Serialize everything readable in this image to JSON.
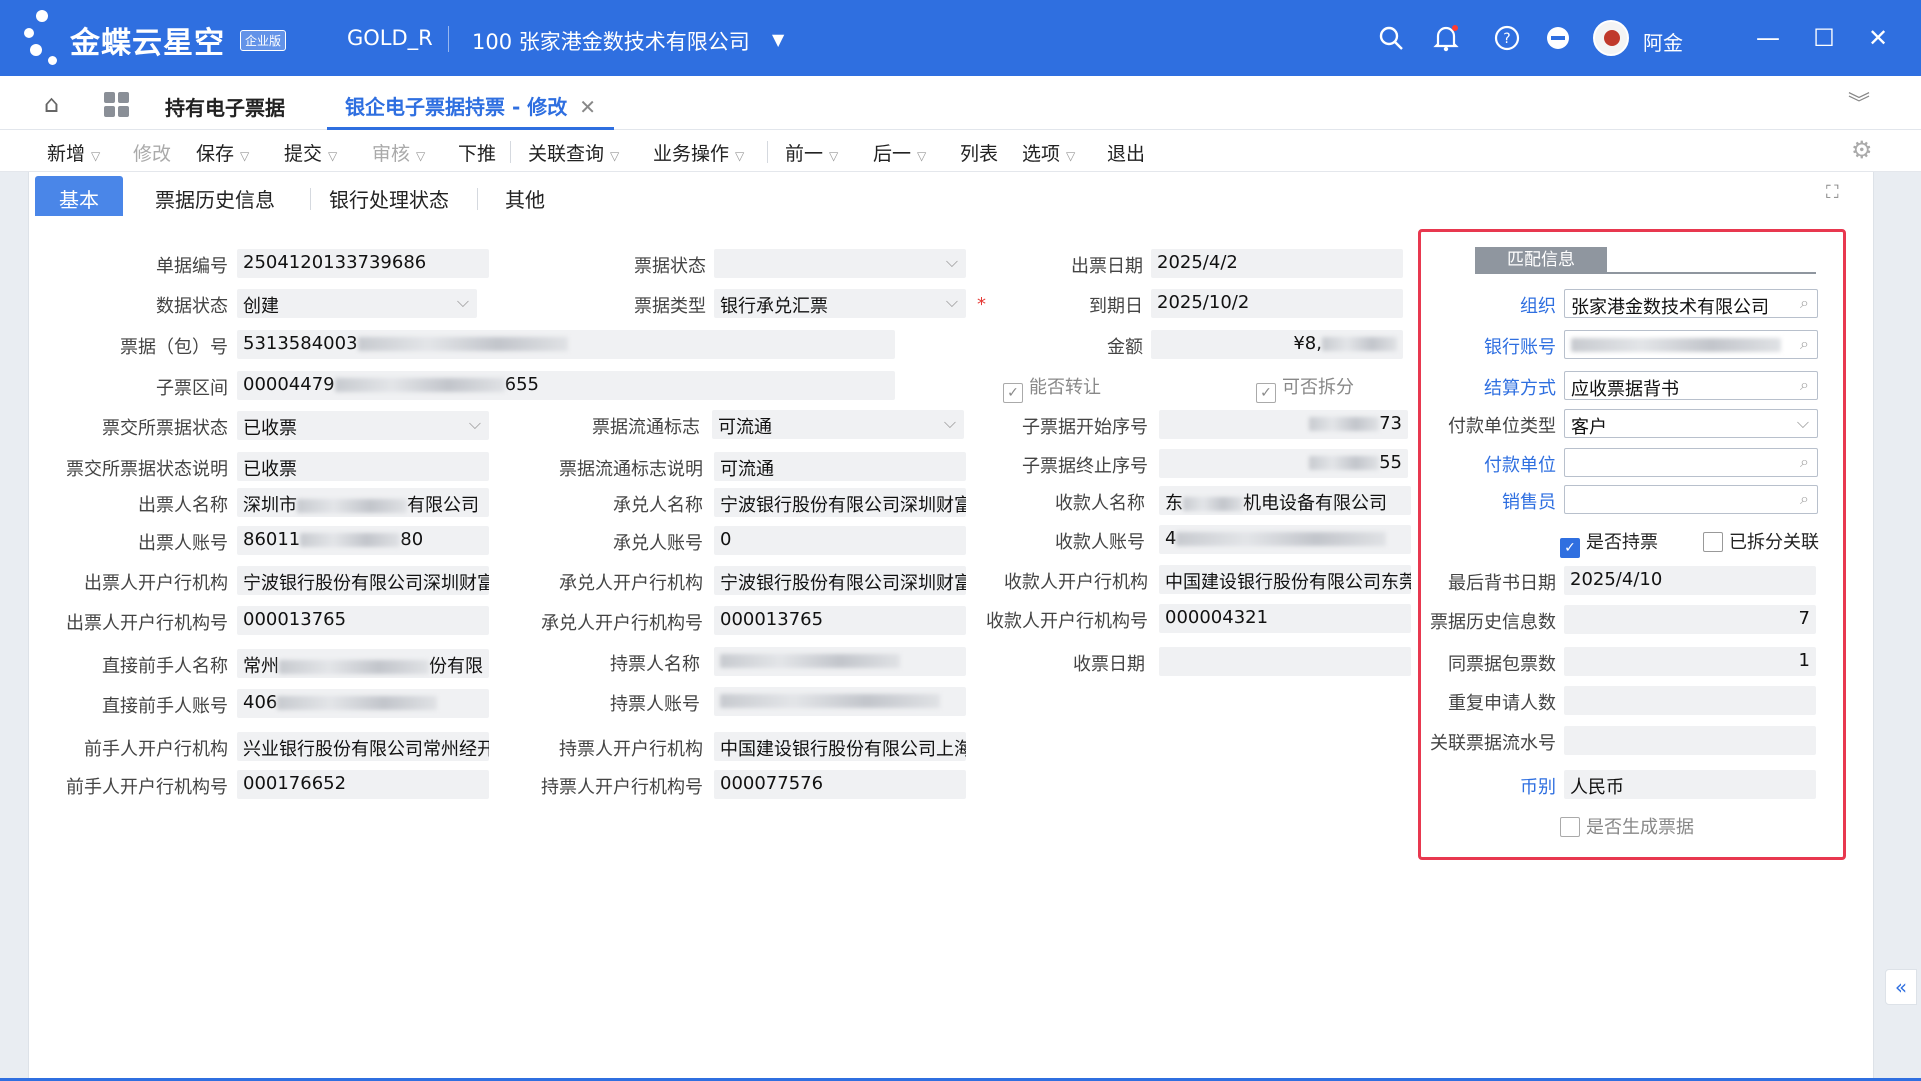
{
  "header": {
    "brand": "金蝶云星空",
    "edition": "企业版",
    "account": "GOLD_R",
    "company": "100 张家港金数技术有限公司",
    "user": "阿金",
    "icons": [
      "search-icon",
      "bell-icon",
      "help-icon",
      "minus-circle-icon"
    ]
  },
  "tabs": {
    "list_tab": "持有电子票据",
    "active_tab": "银企电子票据持票 - 修改"
  },
  "toolbar": {
    "items": [
      "新增",
      "修改",
      "保存",
      "提交",
      "审核",
      "下推",
      "关联查询",
      "业务操作",
      "前一",
      "后一",
      "列表",
      "选项",
      "退出"
    ]
  },
  "subtabs": [
    "基本",
    "票据历史信息",
    "银行处理状态",
    "其他"
  ],
  "form": {
    "col1": {
      "labels": [
        "单据编号",
        "数据状态",
        "票据（包）号",
        "子票区间",
        "票交所票据状态",
        "票交所票据状态说明",
        "出票人名称",
        "出票人账号",
        "出票人开户行机构",
        "出票人开户行机构号",
        "直接前手人名称",
        "直接前手人账号",
        "前手人开户行机构",
        "前手人开户行机构号"
      ],
      "bill_no": "2504120133739686",
      "data_status": "创建",
      "bill_pkg_no_prefix": "5313584003",
      "sub_range_prefix": "00004479",
      "sub_range_suffix": "655",
      "exch_status": "已收票",
      "exch_status_desc": "已收票",
      "drawer_name_prefix": "深圳市",
      "drawer_name_suffix": "有限公司",
      "drawer_acct_prefix": "86011",
      "drawer_acct_suffix": "80",
      "drawer_bank": "宁波银行股份有限公司深圳财富",
      "drawer_bank_no": "000013765",
      "prev_name_prefix": "常州",
      "prev_name_suffix": "份有限",
      "prev_acct_prefix": "406",
      "prev_bank": "兴业银行股份有限公司常州经开",
      "prev_bank_no": "000176652"
    },
    "col2": {
      "labels": [
        "票据状态",
        "票据类型",
        "票据流通标志",
        "票据流通标志说明",
        "承兑人名称",
        "承兑人账号",
        "承兑人开户行机构",
        "承兑人开户行机构号",
        "持票人名称",
        "持票人账号",
        "持票人开户行机构",
        "持票人开户行机构号"
      ],
      "bill_status": "",
      "bill_type": "银行承兑汇票",
      "circ_flag": "可流通",
      "circ_desc": "可流通",
      "acceptor_name": "宁波银行股份有限公司深圳财富",
      "acceptor_acct": "0",
      "acceptor_bank": "宁波银行股份有限公司深圳财富",
      "acceptor_bank_no": "000013765",
      "holder_bank": "中国建设银行股份有限公司上海",
      "holder_bank_no": "000077576"
    },
    "col3": {
      "labels": [
        "出票日期",
        "到期日",
        "金额",
        "子票据开始序号",
        "子票据终止序号",
        "收款人名称",
        "收款人账号",
        "收款人开户行机构",
        "收款人开户行机构号",
        "收票日期"
      ],
      "issue_date": "2025/4/2",
      "due_date": "2025/10/2",
      "amount_prefix": "¥8,",
      "can_transfer": "能否转让",
      "can_split": "可否拆分",
      "sub_start_suffix": "73",
      "sub_end_suffix": "55",
      "payee_name_prefix": "东",
      "payee_name_suffix": "机电设备有限公司",
      "payee_acct_prefix": "4",
      "payee_bank": "中国建设银行股份有限公司东莞",
      "payee_bank_no": "000004321",
      "receive_date": ""
    },
    "match": {
      "header": "匹配信息",
      "labels": [
        "组织",
        "银行账号",
        "结算方式",
        "付款单位类型",
        "付款单位",
        "销售员",
        "最后背书日期",
        "票据历史信息数",
        "同票据包票数",
        "重复申请人数",
        "关联票据流水号",
        "币别"
      ],
      "org": "张家港金数技术有限公司",
      "settle": "应收票据背书",
      "payer_type": "客户",
      "payer": "",
      "salesman": "",
      "is_held": "是否持票",
      "is_split": "已拆分关联",
      "last_endorse": "2025/4/10",
      "history_count": "7",
      "pkg_count": "1",
      "dup_count": "",
      "related_serial": "",
      "currency": "人民币",
      "gen_bill": "是否生成票据"
    }
  },
  "colors": {
    "brand": "#2f6fe0",
    "highlight": "#e8384f"
  }
}
